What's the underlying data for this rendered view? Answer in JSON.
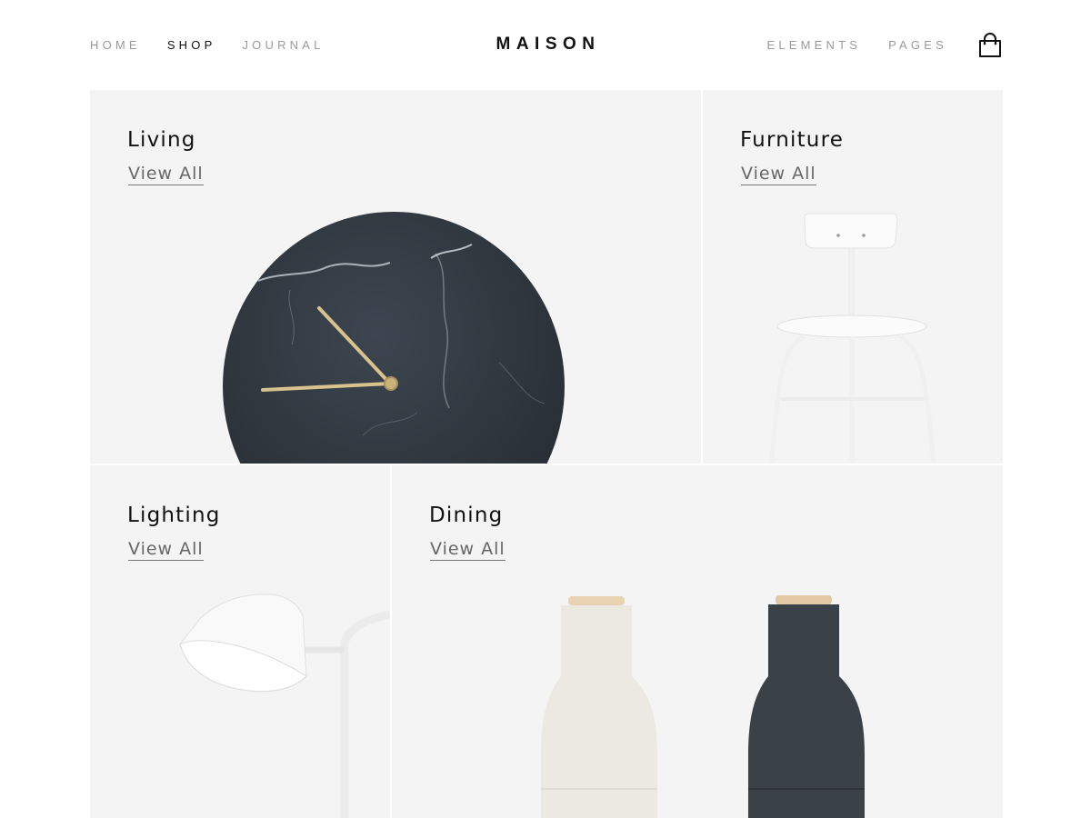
{
  "header": {
    "logo": "MAISON",
    "nav_left": [
      {
        "label": "HOME",
        "active": false
      },
      {
        "label": "SHOP",
        "active": true
      },
      {
        "label": "JOURNAL",
        "active": false
      }
    ],
    "nav_right": [
      {
        "label": "ELEMENTS"
      },
      {
        "label": "PAGES"
      }
    ],
    "cart_icon": "shopping-bag-icon"
  },
  "categories": [
    {
      "title": "Living",
      "link": "View All",
      "image": "marble-wall-clock"
    },
    {
      "title": "Furniture",
      "link": "View All",
      "image": "white-bar-stool"
    },
    {
      "title": "Lighting",
      "link": "View All",
      "image": "white-floor-lamp"
    },
    {
      "title": "Dining",
      "link": "View All",
      "image": "salt-pepper-grinders"
    }
  ],
  "colors": {
    "background": "#ffffff",
    "tile_background": "#f4f4f4",
    "text_primary": "#111111",
    "text_muted": "#9a9a9a",
    "link": "#666666"
  }
}
